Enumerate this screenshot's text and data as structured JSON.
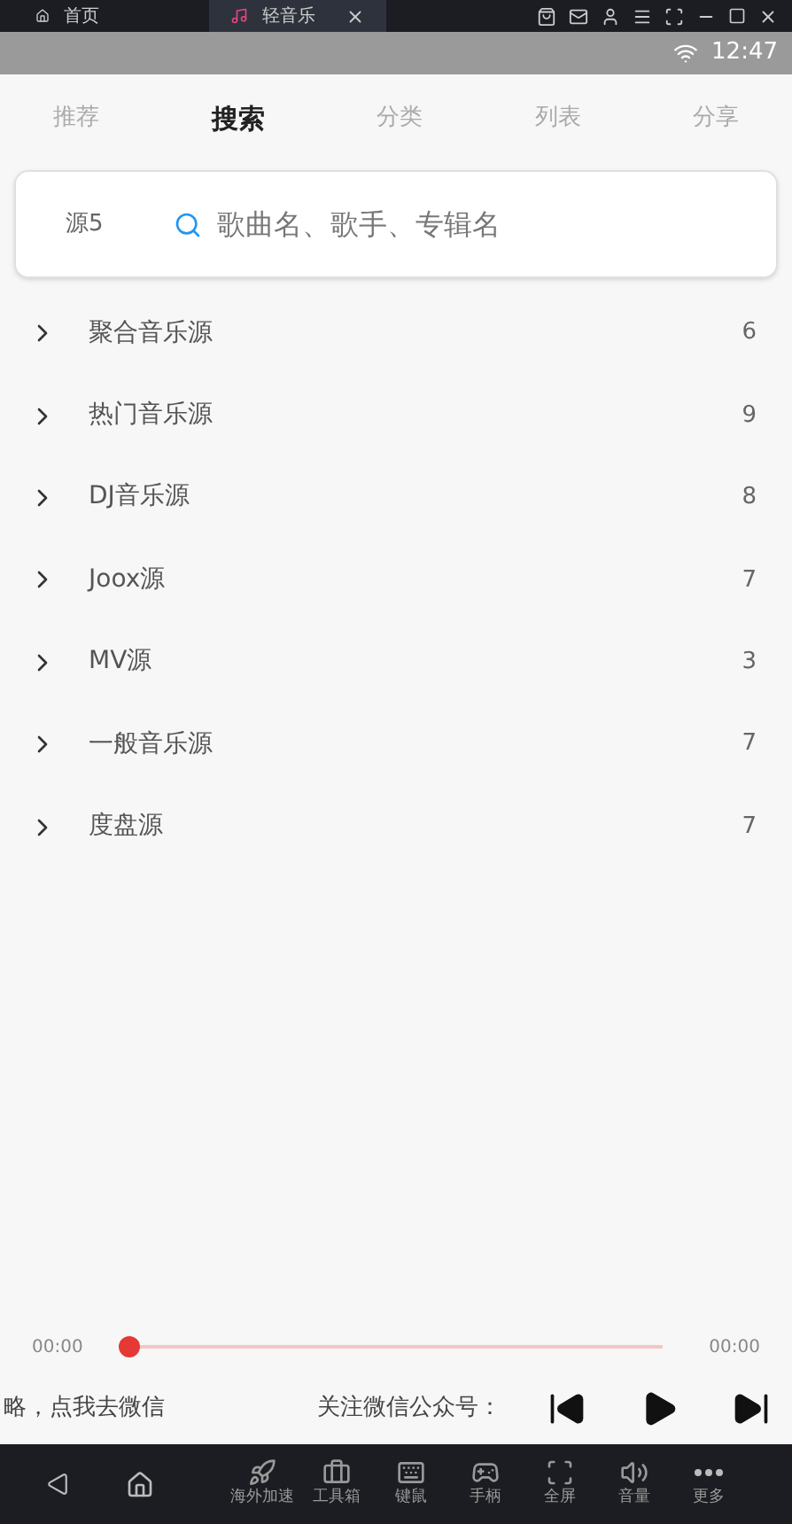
{
  "window_tabs": [
    {
      "label": "首页",
      "kind": "home",
      "selected": false
    },
    {
      "label": "轻音乐",
      "kind": "app",
      "selected": true
    }
  ],
  "status_bar": {
    "time": "12:47"
  },
  "tabs": [
    {
      "label": "推荐",
      "selected": false
    },
    {
      "label": "搜索",
      "selected": true
    },
    {
      "label": "分类",
      "selected": false
    },
    {
      "label": "列表",
      "selected": false
    },
    {
      "label": "分享",
      "selected": false
    }
  ],
  "search": {
    "source": "源5",
    "placeholder": "歌曲名、歌手、专辑名"
  },
  "sources": [
    {
      "name": "聚合音乐源",
      "count": "6"
    },
    {
      "name": "热门音乐源",
      "count": "9"
    },
    {
      "name": "DJ音乐源",
      "count": "8"
    },
    {
      "name": "Joox源",
      "count": "7"
    },
    {
      "name": "MV源",
      "count": "3"
    },
    {
      "name": "一般音乐源",
      "count": "7"
    },
    {
      "name": "度盘源",
      "count": "7"
    }
  ],
  "player": {
    "elapsed": "00:00",
    "total": "00:00",
    "level": 0,
    "marquee_left": "略，点我去微信",
    "marquee_right": "关注微信公众号："
  },
  "toolbar": [
    {
      "label": "海外加速",
      "kind": "rocket"
    },
    {
      "label": "工具箱",
      "kind": "toolbox"
    },
    {
      "label": "键鼠",
      "kind": "keyboard"
    },
    {
      "label": "手柄",
      "kind": "gamepad"
    },
    {
      "label": "全屏",
      "kind": "fullscreen"
    },
    {
      "label": "音量",
      "kind": "volume"
    },
    {
      "label": "更多",
      "kind": "more"
    }
  ]
}
